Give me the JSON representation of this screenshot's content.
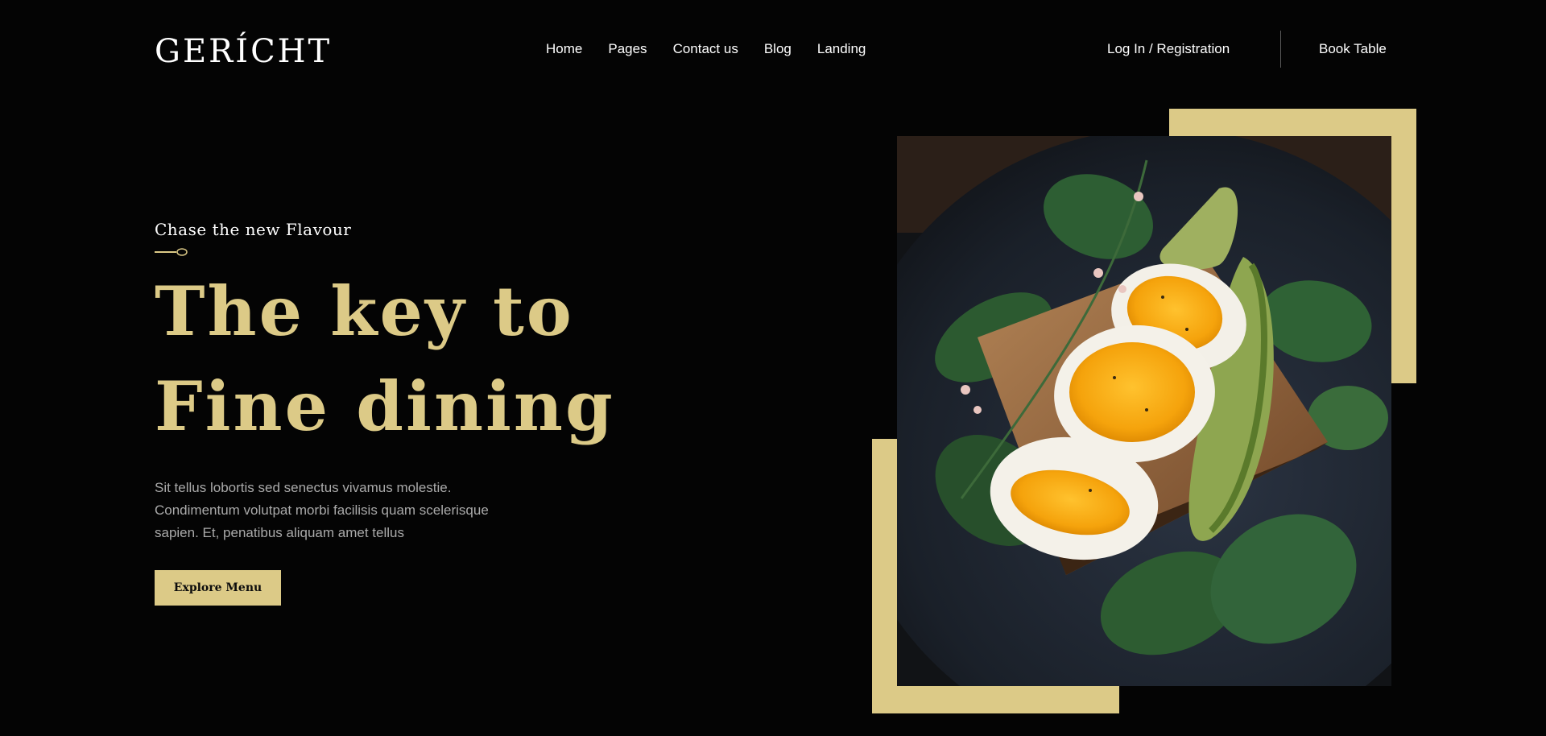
{
  "brand": {
    "logo_text": "GERÍCHT"
  },
  "nav": {
    "links": [
      "Home",
      "Pages",
      "Contact us",
      "Blog",
      "Landing"
    ],
    "login_label": "Log In / Registration",
    "book_label": "Book Table"
  },
  "hero": {
    "subtitle": "Chase the new Flavour",
    "headline_line1": "The key to",
    "headline_line2": "Fine dining",
    "description": "Sit tellus lobortis sed senectus vivamus molestie. Condimentum volutpat morbi facilisis quam scelerisque sapien. Et, penatibus aliquam amet tellus",
    "cta_label": "Explore Menu"
  },
  "colors": {
    "background": "#040404",
    "accent_gold": "#dcca87",
    "text_white": "#ffffff",
    "text_grey": "#aaaaaa"
  },
  "icons": {
    "spoon": "spoon-icon",
    "food_photo": "egg-toast-photo"
  }
}
